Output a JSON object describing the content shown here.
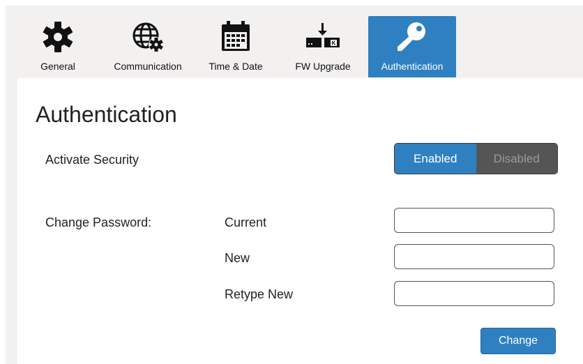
{
  "tabs": [
    {
      "label": "General",
      "icon": "gear-icon"
    },
    {
      "label": "Communication",
      "icon": "globe-gear-icon"
    },
    {
      "label": "Time & Date",
      "icon": "calendar-icon"
    },
    {
      "label": "FW Upgrade",
      "icon": "firmware-download-icon"
    },
    {
      "label": "Authentication",
      "icon": "key-icon",
      "active": true
    }
  ],
  "panel": {
    "title": "Authentication",
    "activate_security": {
      "label": "Activate Security",
      "enabled_label": "Enabled",
      "disabled_label": "Disabled",
      "selected": "Enabled"
    },
    "change_password": {
      "label": "Change Password:",
      "current_label": "Current",
      "current_value": "",
      "new_label": "New",
      "new_value": "",
      "retype_label": "Retype New",
      "retype_value": "",
      "button_label": "Change"
    }
  },
  "colors": {
    "accent": "#2f80c1",
    "disabled_segment": "#555555",
    "frame_bg": "#f3f0f0"
  }
}
